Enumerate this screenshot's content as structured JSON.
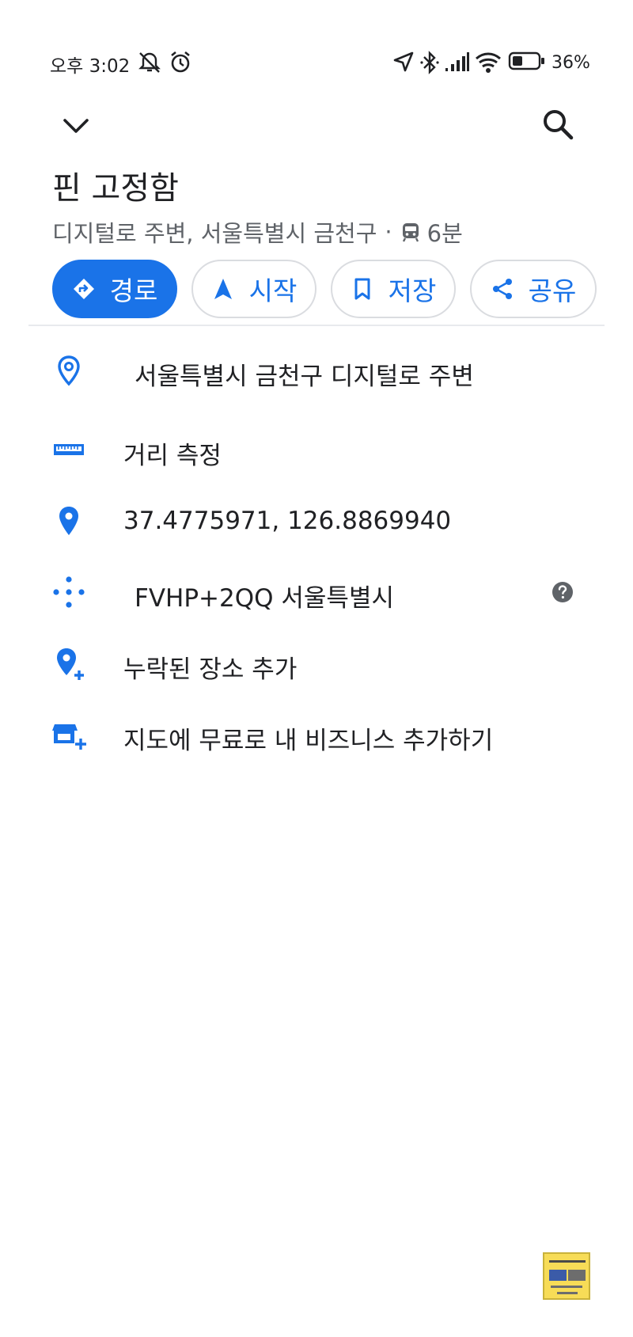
{
  "status_bar": {
    "time": "오후 3:02",
    "battery": "36%",
    "icons": [
      "mute-icon",
      "alarm-icon",
      "location-arrow-icon",
      "bluetooth-icon",
      "signal-icon",
      "wifi-icon",
      "battery-icon"
    ]
  },
  "header": {
    "title": "핀 고정함",
    "subtitle_place": "디지털로 주변, 서울특별시 금천구",
    "subtitle_separator": "·",
    "transit_time": "6분"
  },
  "actions": [
    {
      "label": "경로",
      "icon": "directions-icon"
    },
    {
      "label": "시작",
      "icon": "navigation-icon"
    },
    {
      "label": "저장",
      "icon": "bookmark-icon"
    },
    {
      "label": "공유",
      "icon": "share-icon"
    }
  ],
  "rows": {
    "address": "서울특별시 금천구 디지털로 주변",
    "measure": "거리 측정",
    "coordinates": "37.4775971, 126.8869940",
    "plus_code": "FVHP+2QQ 서울특별시",
    "add_missing_place": "누락된 장소 추가",
    "add_business": "지도에 무료로 내 비즈니스 추가하기"
  },
  "colors": {
    "accent": "#1a73e8",
    "text": "#202124",
    "secondary_text": "#5f6368",
    "watermark": "#f7dc57"
  }
}
